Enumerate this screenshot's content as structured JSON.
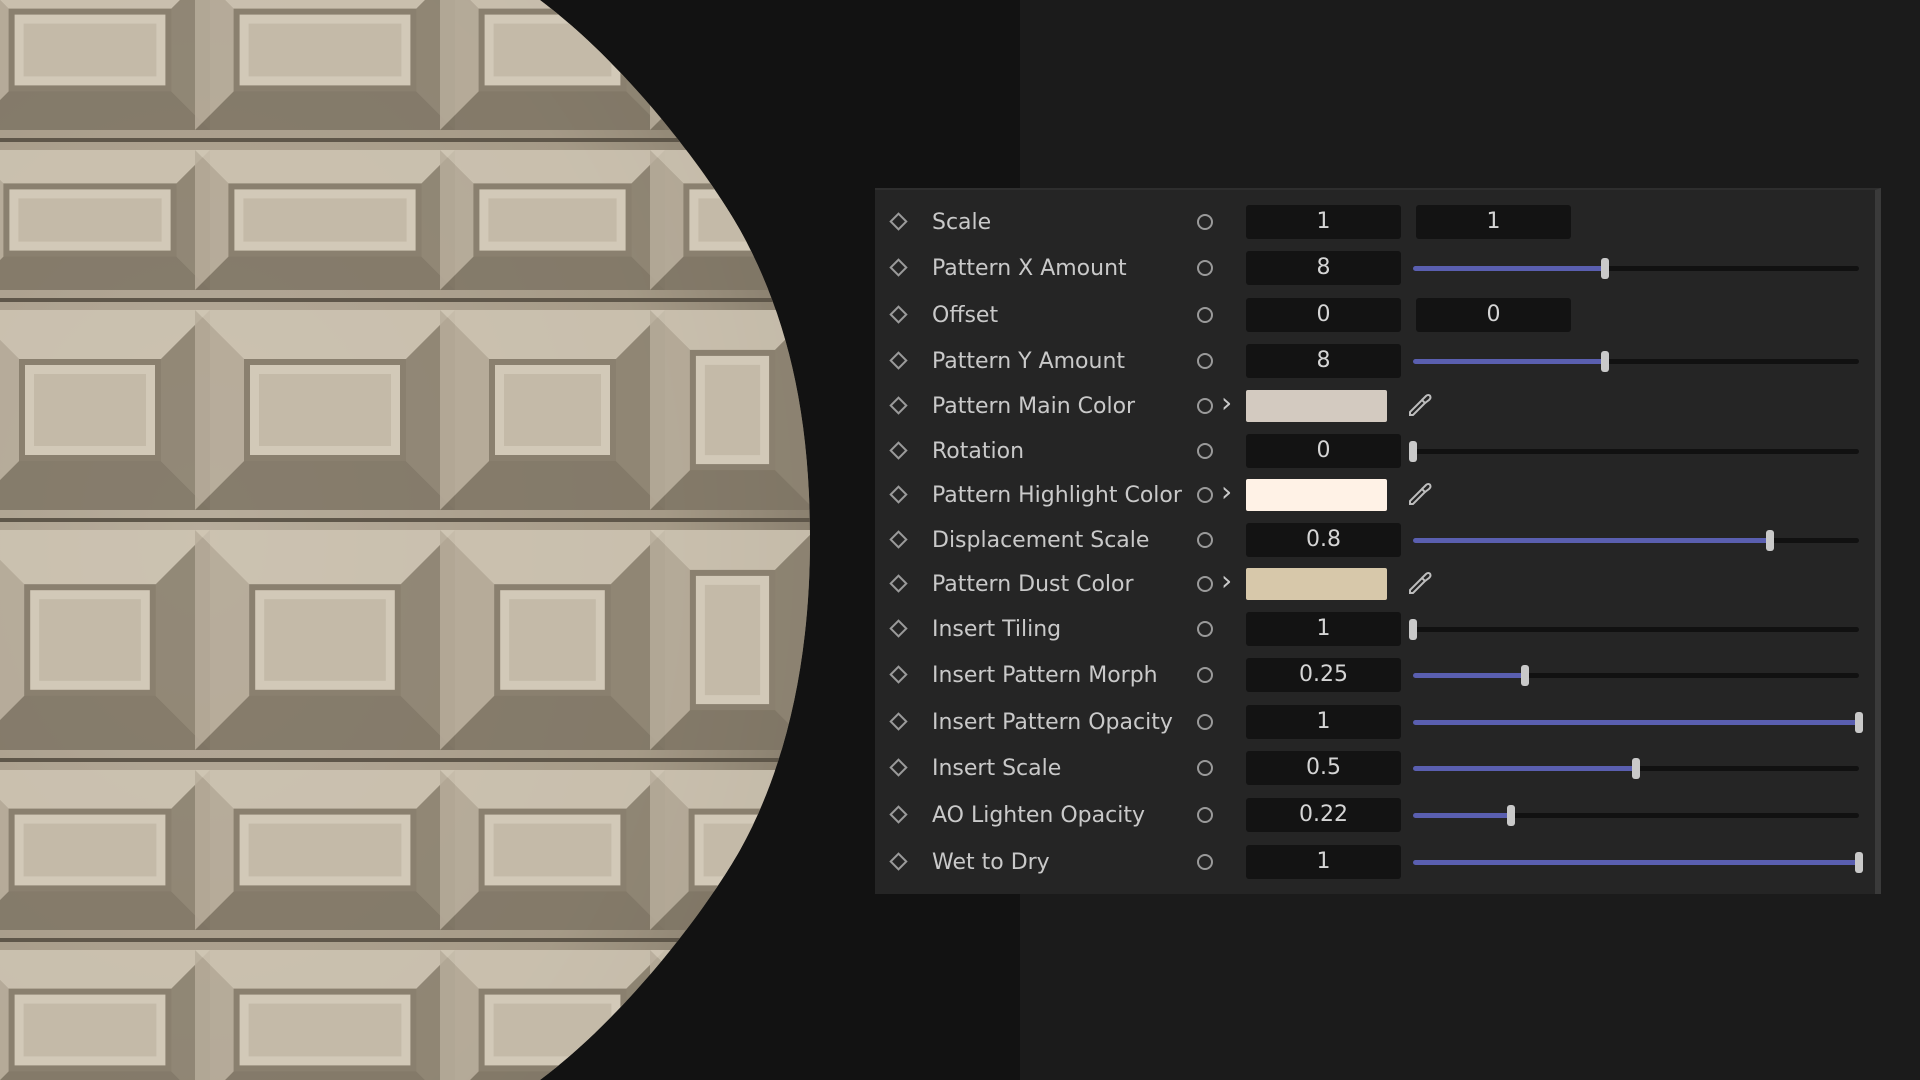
{
  "panel": {
    "rows": [
      {
        "label": "Scale",
        "kind": "pair",
        "value": "1",
        "value2": "1"
      },
      {
        "label": "Pattern X Amount",
        "kind": "slider",
        "value": "8",
        "level": 0.43
      },
      {
        "label": "Offset",
        "kind": "pair",
        "value": "0",
        "value2": "0"
      },
      {
        "label": "Pattern Y Amount",
        "kind": "slider",
        "value": "8",
        "level": 0.43
      },
      {
        "label": "Pattern Main Color",
        "kind": "color",
        "color": "#d3cac0"
      },
      {
        "label": "Rotation",
        "kind": "slider",
        "value": "0",
        "level": 0.0
      },
      {
        "label": "Pattern Highlight Color",
        "kind": "color",
        "color": "#fff2e6"
      },
      {
        "label": "Displacement Scale",
        "kind": "slider",
        "value": "0.8",
        "level": 0.8
      },
      {
        "label": "Pattern Dust Color",
        "kind": "color",
        "color": "#d7c8aa"
      },
      {
        "label": "Insert Tiling",
        "kind": "slider",
        "value": "1",
        "level": 0.0
      },
      {
        "label": "Insert Pattern Morph",
        "kind": "slider",
        "value": "0.25",
        "level": 0.25
      },
      {
        "label": "Insert Pattern Opacity",
        "kind": "slider",
        "value": "1",
        "level": 1.0
      },
      {
        "label": "Insert Scale",
        "kind": "slider",
        "value": "0.5",
        "level": 0.5
      },
      {
        "label": "AO Lighten Opacity",
        "kind": "slider",
        "value": "0.22",
        "level": 0.22
      },
      {
        "label": "Wet to Dry",
        "kind": "slider",
        "value": "1",
        "level": 1.0
      }
    ],
    "icons": {
      "keyframe": "keyframe-diamond-icon",
      "animate": "animate-circle-icon",
      "expand": "chevron-right-icon",
      "picker": "eyedropper-icon"
    },
    "slider_color": "#5a5fb0"
  },
  "preview": {
    "material_color": "#b8ad9c"
  }
}
